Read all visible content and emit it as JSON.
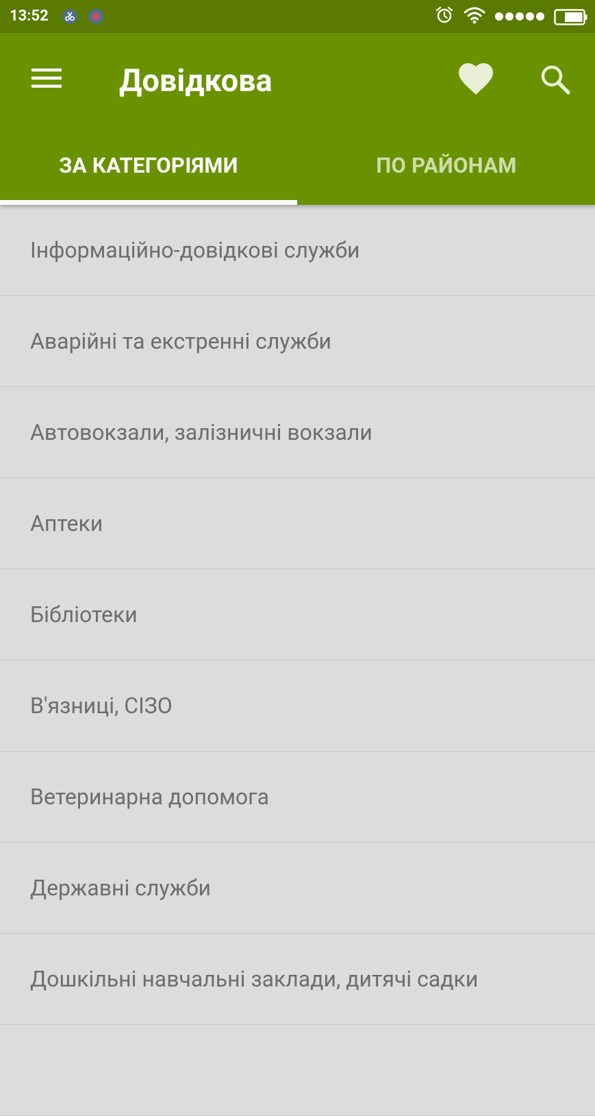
{
  "status_bar": {
    "time": "13:52",
    "icons": [
      "scissors-notification-icon",
      "record-notification-icon",
      "alarm-icon",
      "wifi-icon",
      "signal-icon",
      "battery-icon"
    ]
  },
  "app_bar": {
    "title": "Довідкова",
    "menu_icon": "hamburger-menu-icon",
    "favorites_icon": "heart-icon",
    "search_icon": "search-icon",
    "color": "#6a9200",
    "status_color": "#5a7a00"
  },
  "tabs": [
    {
      "label": "ЗА КАТЕГОРІЯМИ",
      "selected": true
    },
    {
      "label": "ПО РАЙОНАМ",
      "selected": false
    }
  ],
  "categories": [
    {
      "label": "Інформаційно-довідкові служби"
    },
    {
      "label": "Аварійні та екстренні служби"
    },
    {
      "label": "Автовокзали, залізничні вокзали"
    },
    {
      "label": "Аптеки"
    },
    {
      "label": "Бібліотеки"
    },
    {
      "label": "В'язниці, СІЗО"
    },
    {
      "label": "Ветеринарна допомога"
    },
    {
      "label": "Державні служби"
    },
    {
      "label": "Дошкільні навчальні заклади, дитячі садки"
    },
    {
      "label": ""
    }
  ]
}
